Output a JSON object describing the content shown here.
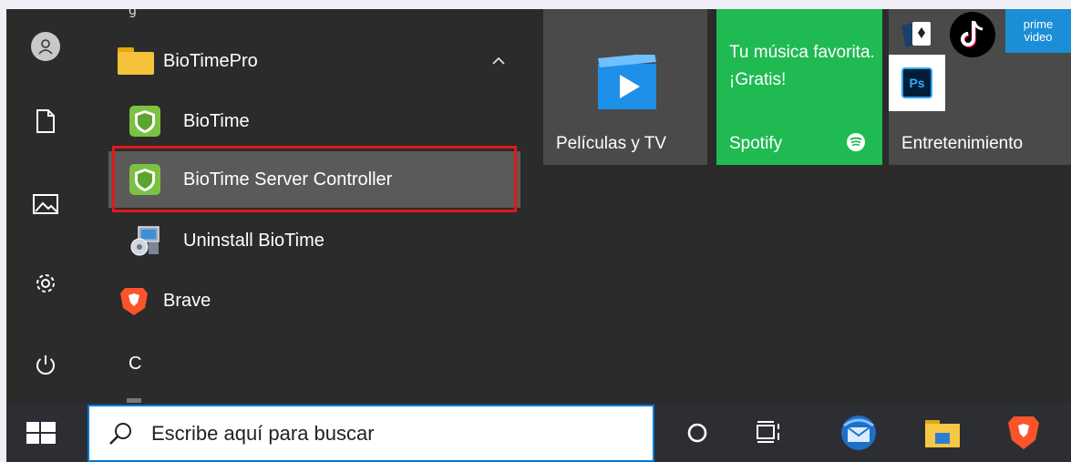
{
  "app_list": {
    "partial_top": "g",
    "folder": {
      "label": "BioTimePro",
      "icon": "folder-icon",
      "expanded": true
    },
    "items": [
      {
        "label": "BioTime",
        "icon": "biotime-icon"
      },
      {
        "label": "BioTime Server Controller",
        "icon": "biotime-icon",
        "highlighted": true
      },
      {
        "label": "Uninstall BioTime",
        "icon": "uninstall-icon"
      },
      {
        "label": "Brave",
        "icon": "brave-icon"
      }
    ],
    "letter_header": "C"
  },
  "rail": [
    "user-icon",
    "document-icon",
    "pictures-icon",
    "settings-icon",
    "power-icon"
  ],
  "tiles": {
    "peliculas": {
      "label": "Películas y TV"
    },
    "spotify": {
      "promo": "Tu música favorita. ¡Gratis!",
      "label": "Spotify"
    },
    "entretenimiento": {
      "label": "Entretenimiento",
      "mini": [
        "solitaire-icon",
        "tiktok-icon",
        "prime-video-icon",
        "photoshop-icon"
      ],
      "prime_top": "prime",
      "prime_bottom": "video",
      "ps_text": "Ps"
    }
  },
  "taskbar": {
    "search_placeholder": "Escribe aquí para buscar",
    "icons": [
      "windows-start-icon",
      "cortana-icon",
      "task-view-icon",
      "mail-icon",
      "file-explorer-icon",
      "brave-icon"
    ]
  },
  "colors": {
    "accent": "#0078d7",
    "spotify": "#1fba52",
    "highlight_border": "#e31818",
    "menu_bg": "#2b2b2b"
  }
}
